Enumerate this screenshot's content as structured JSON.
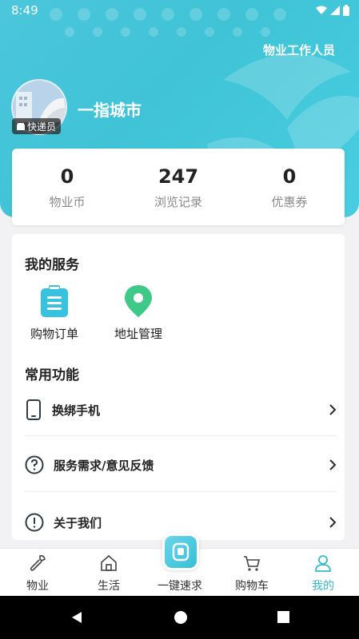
{
  "status_bar": {
    "time": "8:49"
  },
  "header": {
    "role_link": "物业工作人员",
    "username": "一指城市",
    "badge": "快递员"
  },
  "stats": [
    {
      "value": "0",
      "label": "物业币"
    },
    {
      "value": "247",
      "label": "浏览记录"
    },
    {
      "value": "0",
      "label": "优惠券"
    }
  ],
  "services": {
    "title": "我的服务",
    "items": [
      {
        "label": "购物订单",
        "icon": "clipboard-icon"
      },
      {
        "label": "地址管理",
        "icon": "location-pin-icon"
      }
    ]
  },
  "functions": {
    "title": "常用功能",
    "items": [
      {
        "label": "换绑手机",
        "icon": "phone-icon"
      },
      {
        "label": "服务需求/意见反馈",
        "icon": "question-circle-icon"
      },
      {
        "label": "关于我们",
        "icon": "info-circle-icon"
      }
    ]
  },
  "tabbar": {
    "items": [
      {
        "label": "物业",
        "icon": "wrench-icon"
      },
      {
        "label": "生活",
        "icon": "home-icon"
      },
      {
        "label": "一键速求",
        "icon": "service-icon"
      },
      {
        "label": "购物车",
        "icon": "cart-icon"
      },
      {
        "label": "我的",
        "icon": "user-icon",
        "active": true
      }
    ]
  },
  "colors": {
    "accent": "#3fc3d6",
    "active_tab": "#36b9cf",
    "pin": "#3ec989"
  }
}
